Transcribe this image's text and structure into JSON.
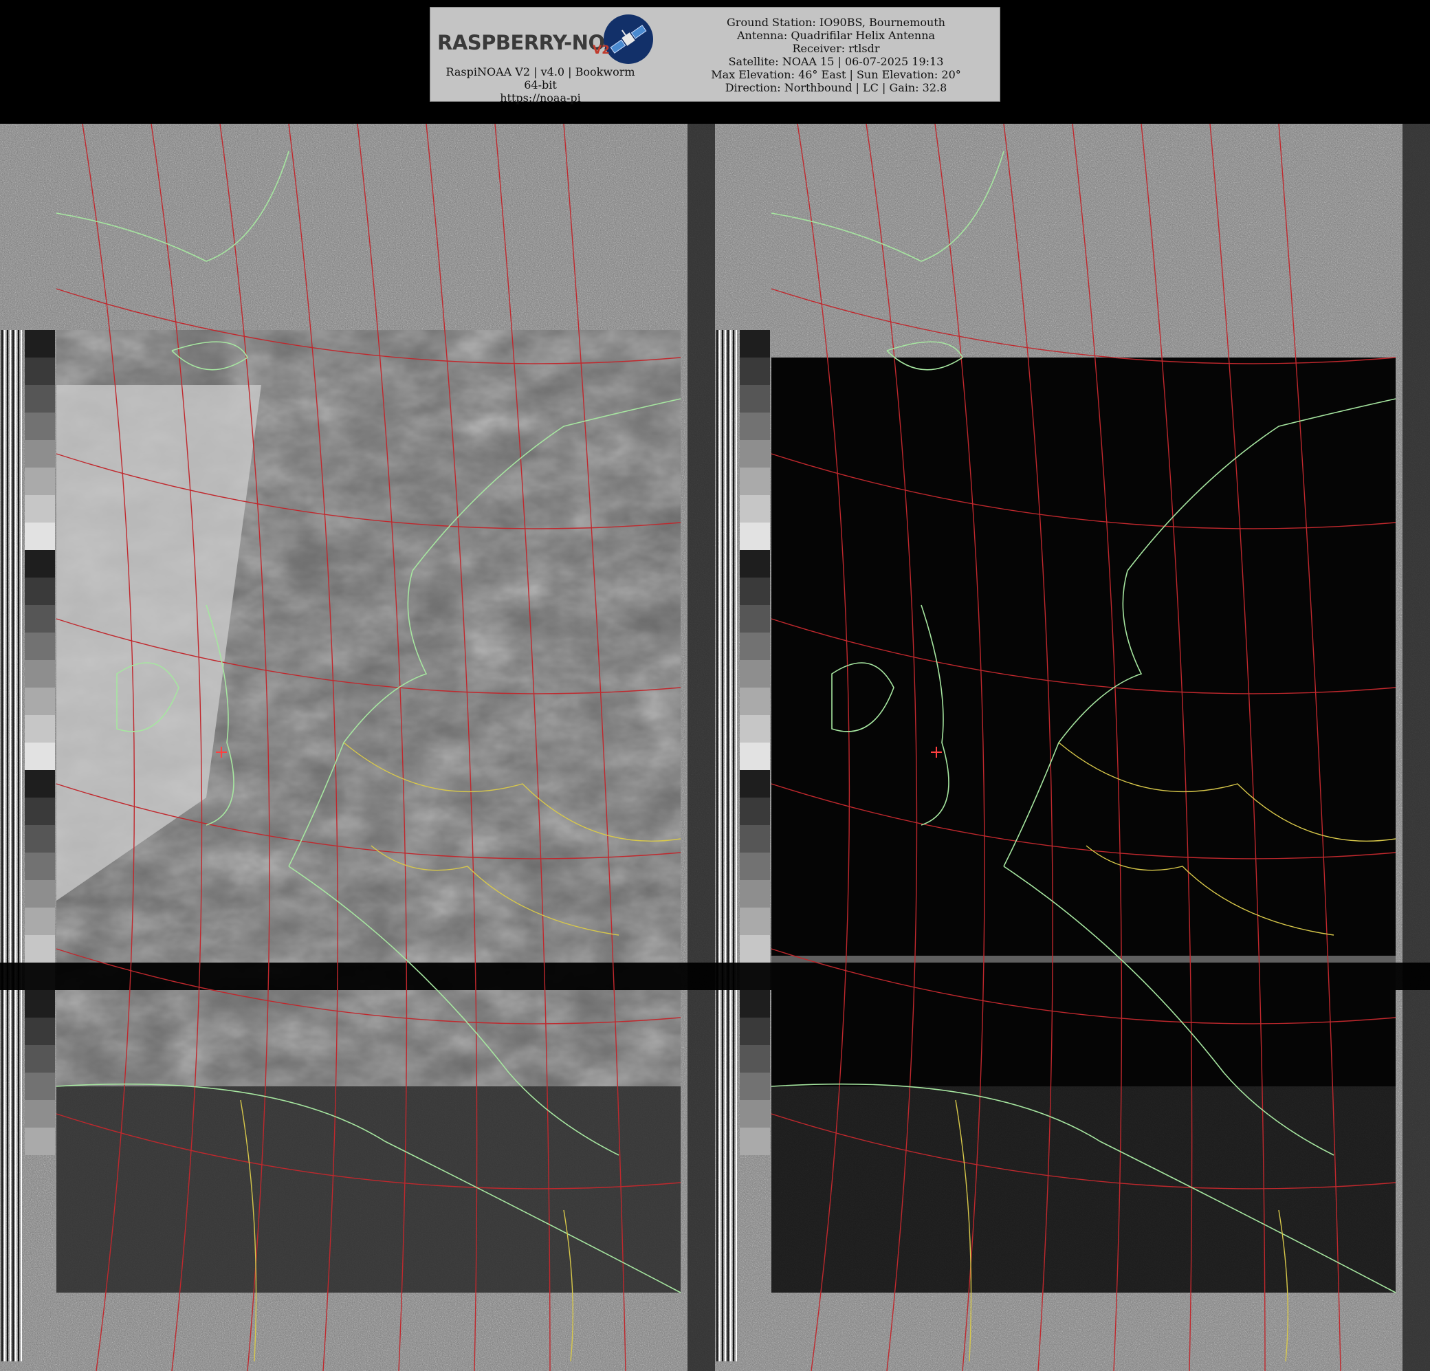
{
  "header": {
    "logo_text": "RASPBERRY-NOAA",
    "logo_version": "V2",
    "left_lines": [
      "RaspiNOAA V2 | v4.0 | Bookworm 64-bit",
      "https://noaa-pi"
    ],
    "right_lines": [
      "Ground Station: IO90BS, Bournemouth",
      "Antenna: Quadrifilar Helix Antenna",
      "Receiver: rtlsdr",
      "Satellite: NOAA 15 | 06-07-2025 19:13",
      "Max Elevation: 46° East | Sun Elevation: 20°",
      "Direction: Northbound | LC | Gain: 32.8"
    ]
  },
  "colors": {
    "background": "#000000",
    "info_panel": "#c4c4c4",
    "graticule": "#c0282d",
    "coastline": "#a6e6a0",
    "borders": "#d8c84a",
    "ground_station_marker": "#ff4040"
  },
  "images": [
    {
      "name": "left-channel-visible",
      "description_icon": "satellite-image"
    },
    {
      "name": "right-channel-infrared",
      "description_icon": "satellite-image"
    }
  ]
}
